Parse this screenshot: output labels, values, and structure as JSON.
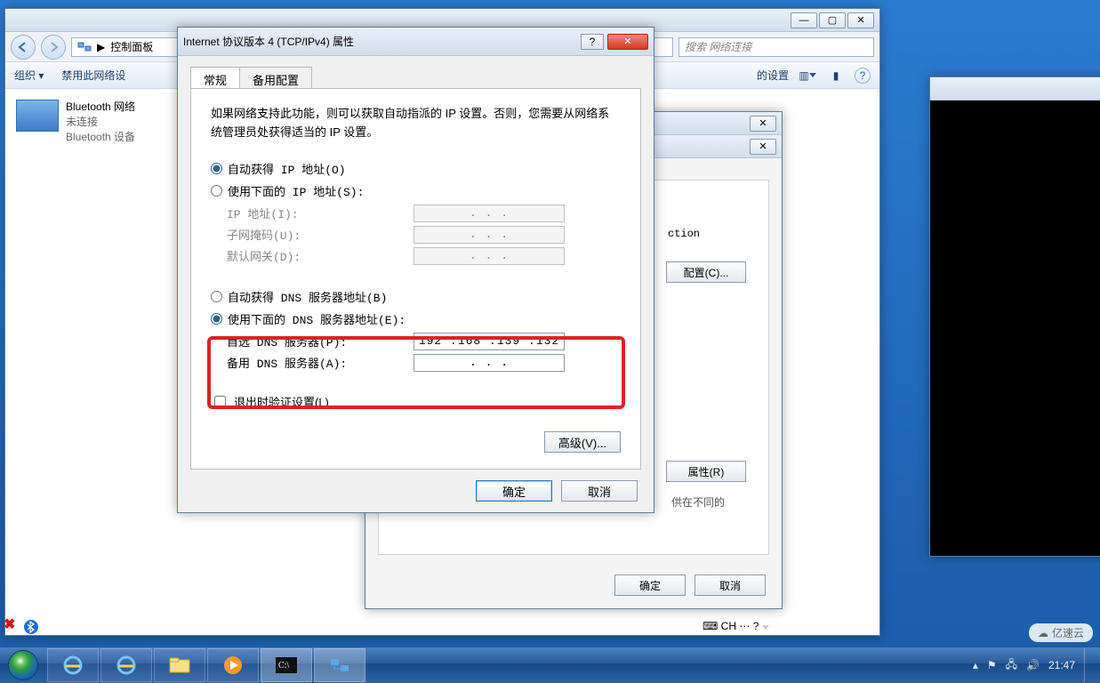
{
  "explorer": {
    "addr_prefix": "▶",
    "addr_text": "控制面板",
    "search_placeholder": "搜索 网络连接",
    "cmd_org": "组织 ▾",
    "cmd_disable": "禁用此网络设",
    "cmd_settings_suffix": "的设置",
    "conn": {
      "title": "Bluetooth 网络",
      "status": "未连接",
      "device": "Bluetooth 设备"
    }
  },
  "dlg2": {
    "ction": "ction",
    "btn_config": "配置(C)...",
    "btn_props": "属性(R)",
    "note": "供在不同的",
    "ok": "确定",
    "cancel": "取消"
  },
  "ipv4": {
    "title": "Internet 协议版本 4 (TCP/IPv4) 属性",
    "tab_general": "常规",
    "tab_alt": "备用配置",
    "desc": "如果网络支持此功能，则可以获取自动指派的 IP 设置。否则，您需要从网络系统管理员处获得适当的 IP 设置。",
    "r_auto_ip": "自动获得 IP 地址(O)",
    "r_manual_ip": "使用下面的 IP 地址(S):",
    "lbl_ip": "IP 地址(I):",
    "lbl_mask": "子网掩码(U):",
    "lbl_gw": "默认网关(D):",
    "r_auto_dns": "自动获得 DNS 服务器地址(B)",
    "r_manual_dns": "使用下面的 DNS 服务器地址(E):",
    "lbl_dns1": "首选 DNS 服务器(P):",
    "lbl_dns2": "备用 DNS 服务器(A):",
    "dns1_value": "192 .168 .139 .132",
    "dot_placeholder": ".       .       .",
    "chk_validate": "退出时验证设置(L)",
    "btn_adv": "高级(V)...",
    "ok": "确定",
    "cancel": "取消"
  },
  "taskbar": {
    "clock_time": "21:47",
    "lang": "CH",
    "watermark": "亿速云"
  }
}
